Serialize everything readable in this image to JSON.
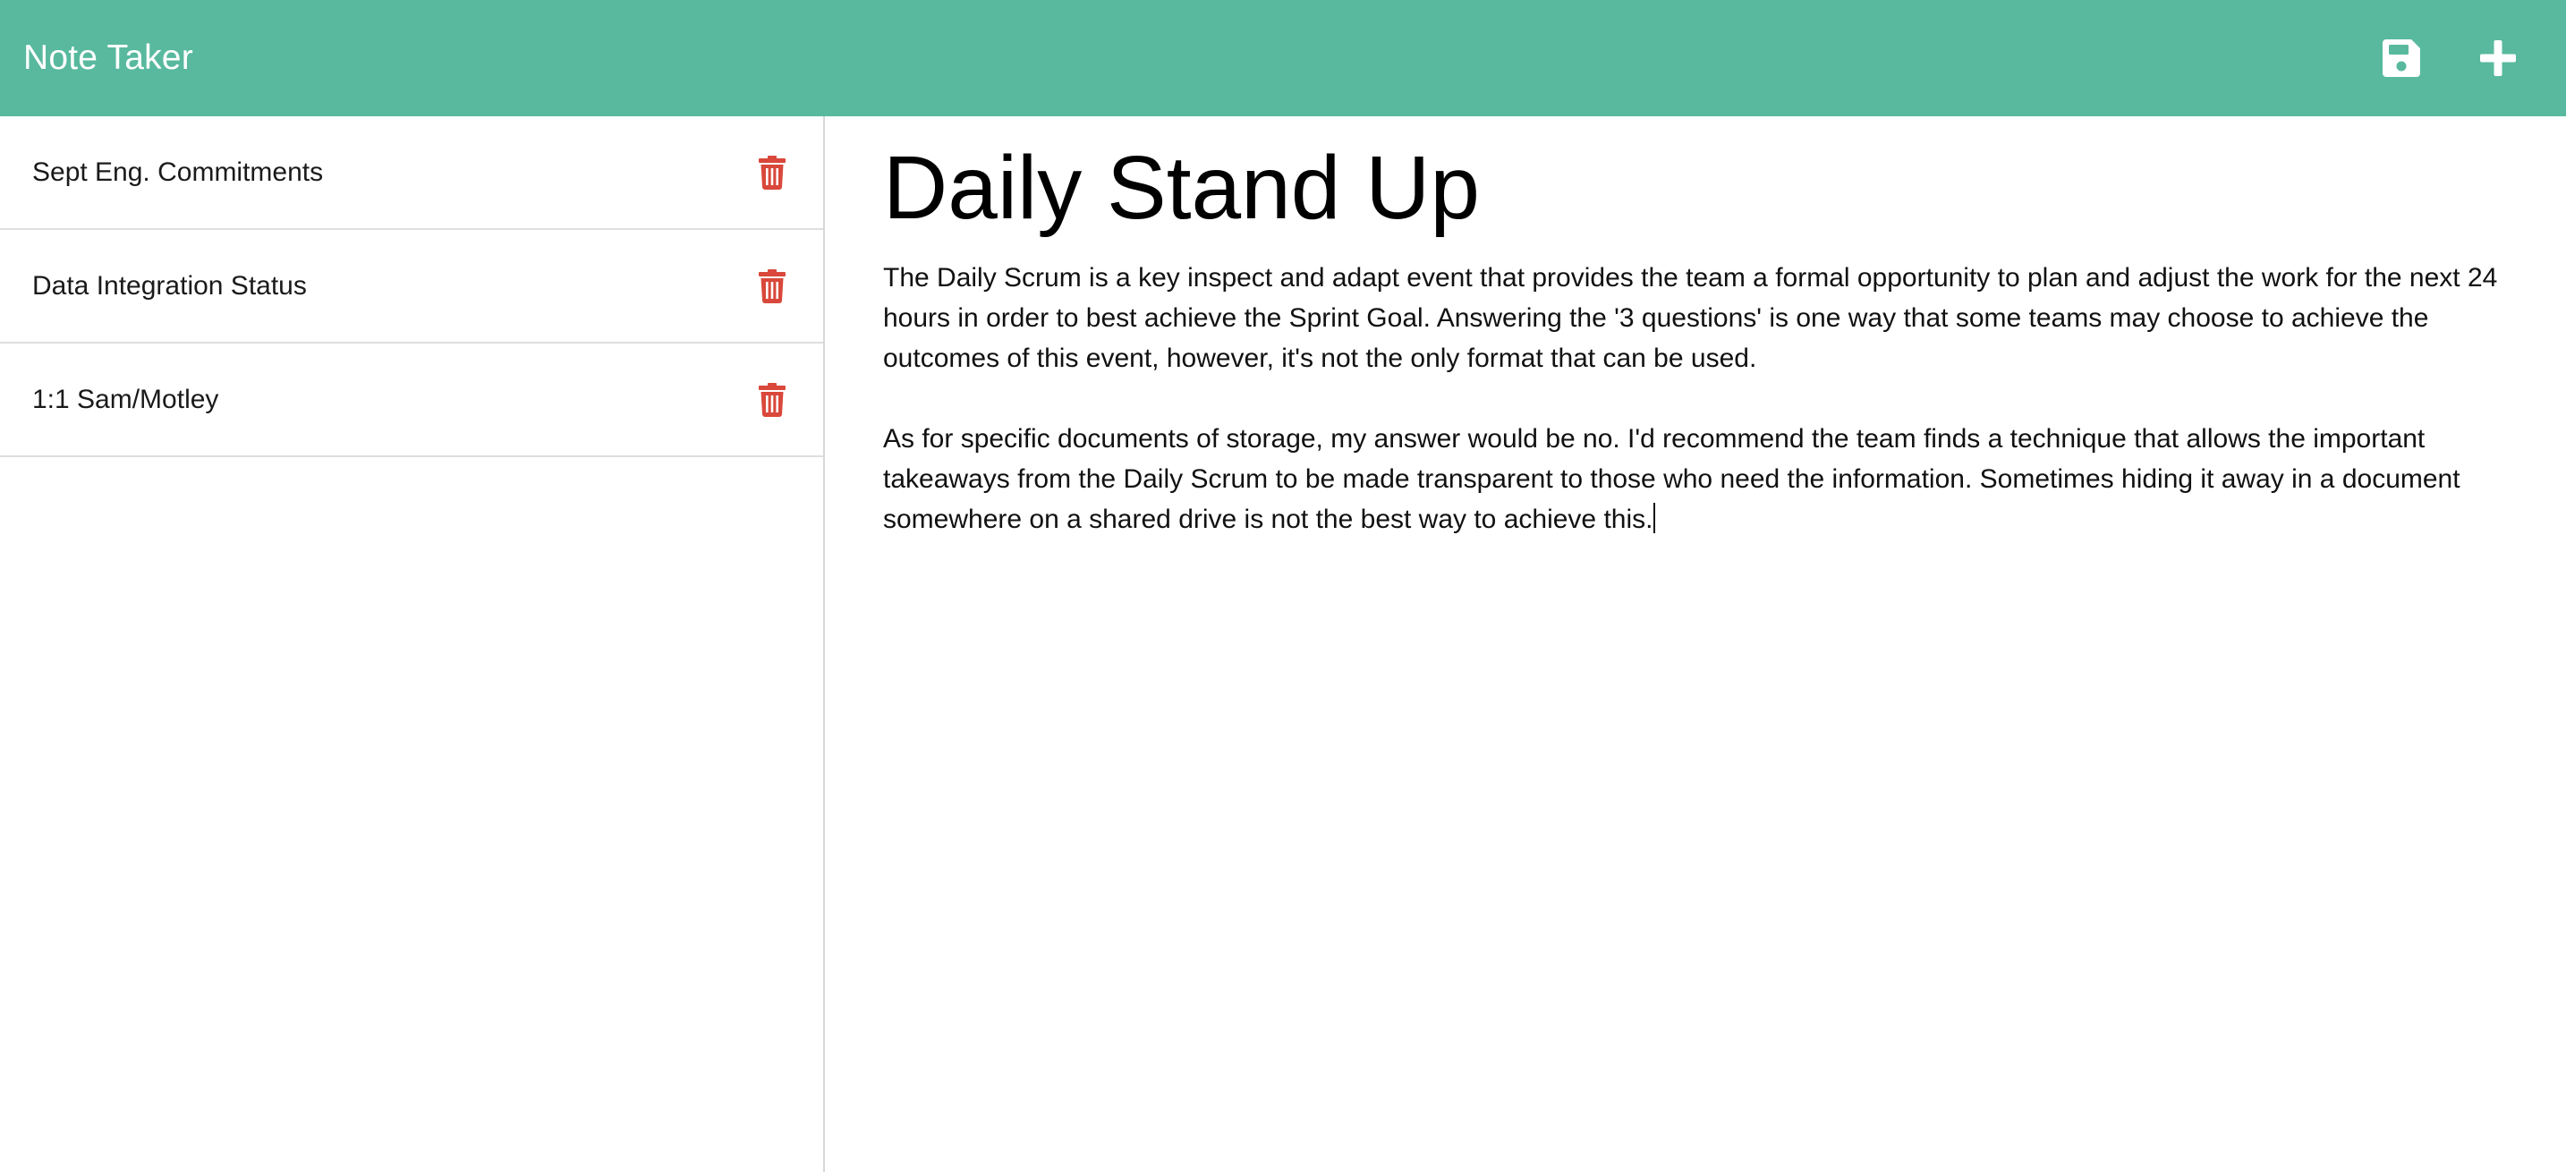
{
  "app": {
    "title": "Note Taker"
  },
  "toolbar": {
    "save_icon": "save-icon",
    "new_icon": "plus-icon"
  },
  "notes": [
    {
      "title": "Sept Eng. Commitments",
      "delete_icon": "trash-icon"
    },
    {
      "title": "Data Integration Status",
      "delete_icon": "trash-icon"
    },
    {
      "title": "1:1 Sam/Motley",
      "delete_icon": "trash-icon"
    }
  ],
  "editor": {
    "title": "Daily Stand Up",
    "paragraphs": [
      "The Daily Scrum is a key inspect and adapt event that provides the team a formal opportunity to plan and adjust the work for the next 24 hours in order to best achieve the Sprint Goal. Answering the '3 questions' is one way that some teams may choose to achieve the outcomes of this event, however, it's not the only format that can be used.",
      "As for specific documents of storage, my answer would be no. I'd recommend the team finds a technique that allows the important takeaways from the Daily Scrum to be made transparent to those who need the information. Sometimes hiding it away in a document somewhere on a shared drive is not the best way to achieve this."
    ]
  },
  "colors": {
    "navbar": "#58b99e",
    "delete": "#d9483b",
    "nav_icon": "#ffffff"
  }
}
